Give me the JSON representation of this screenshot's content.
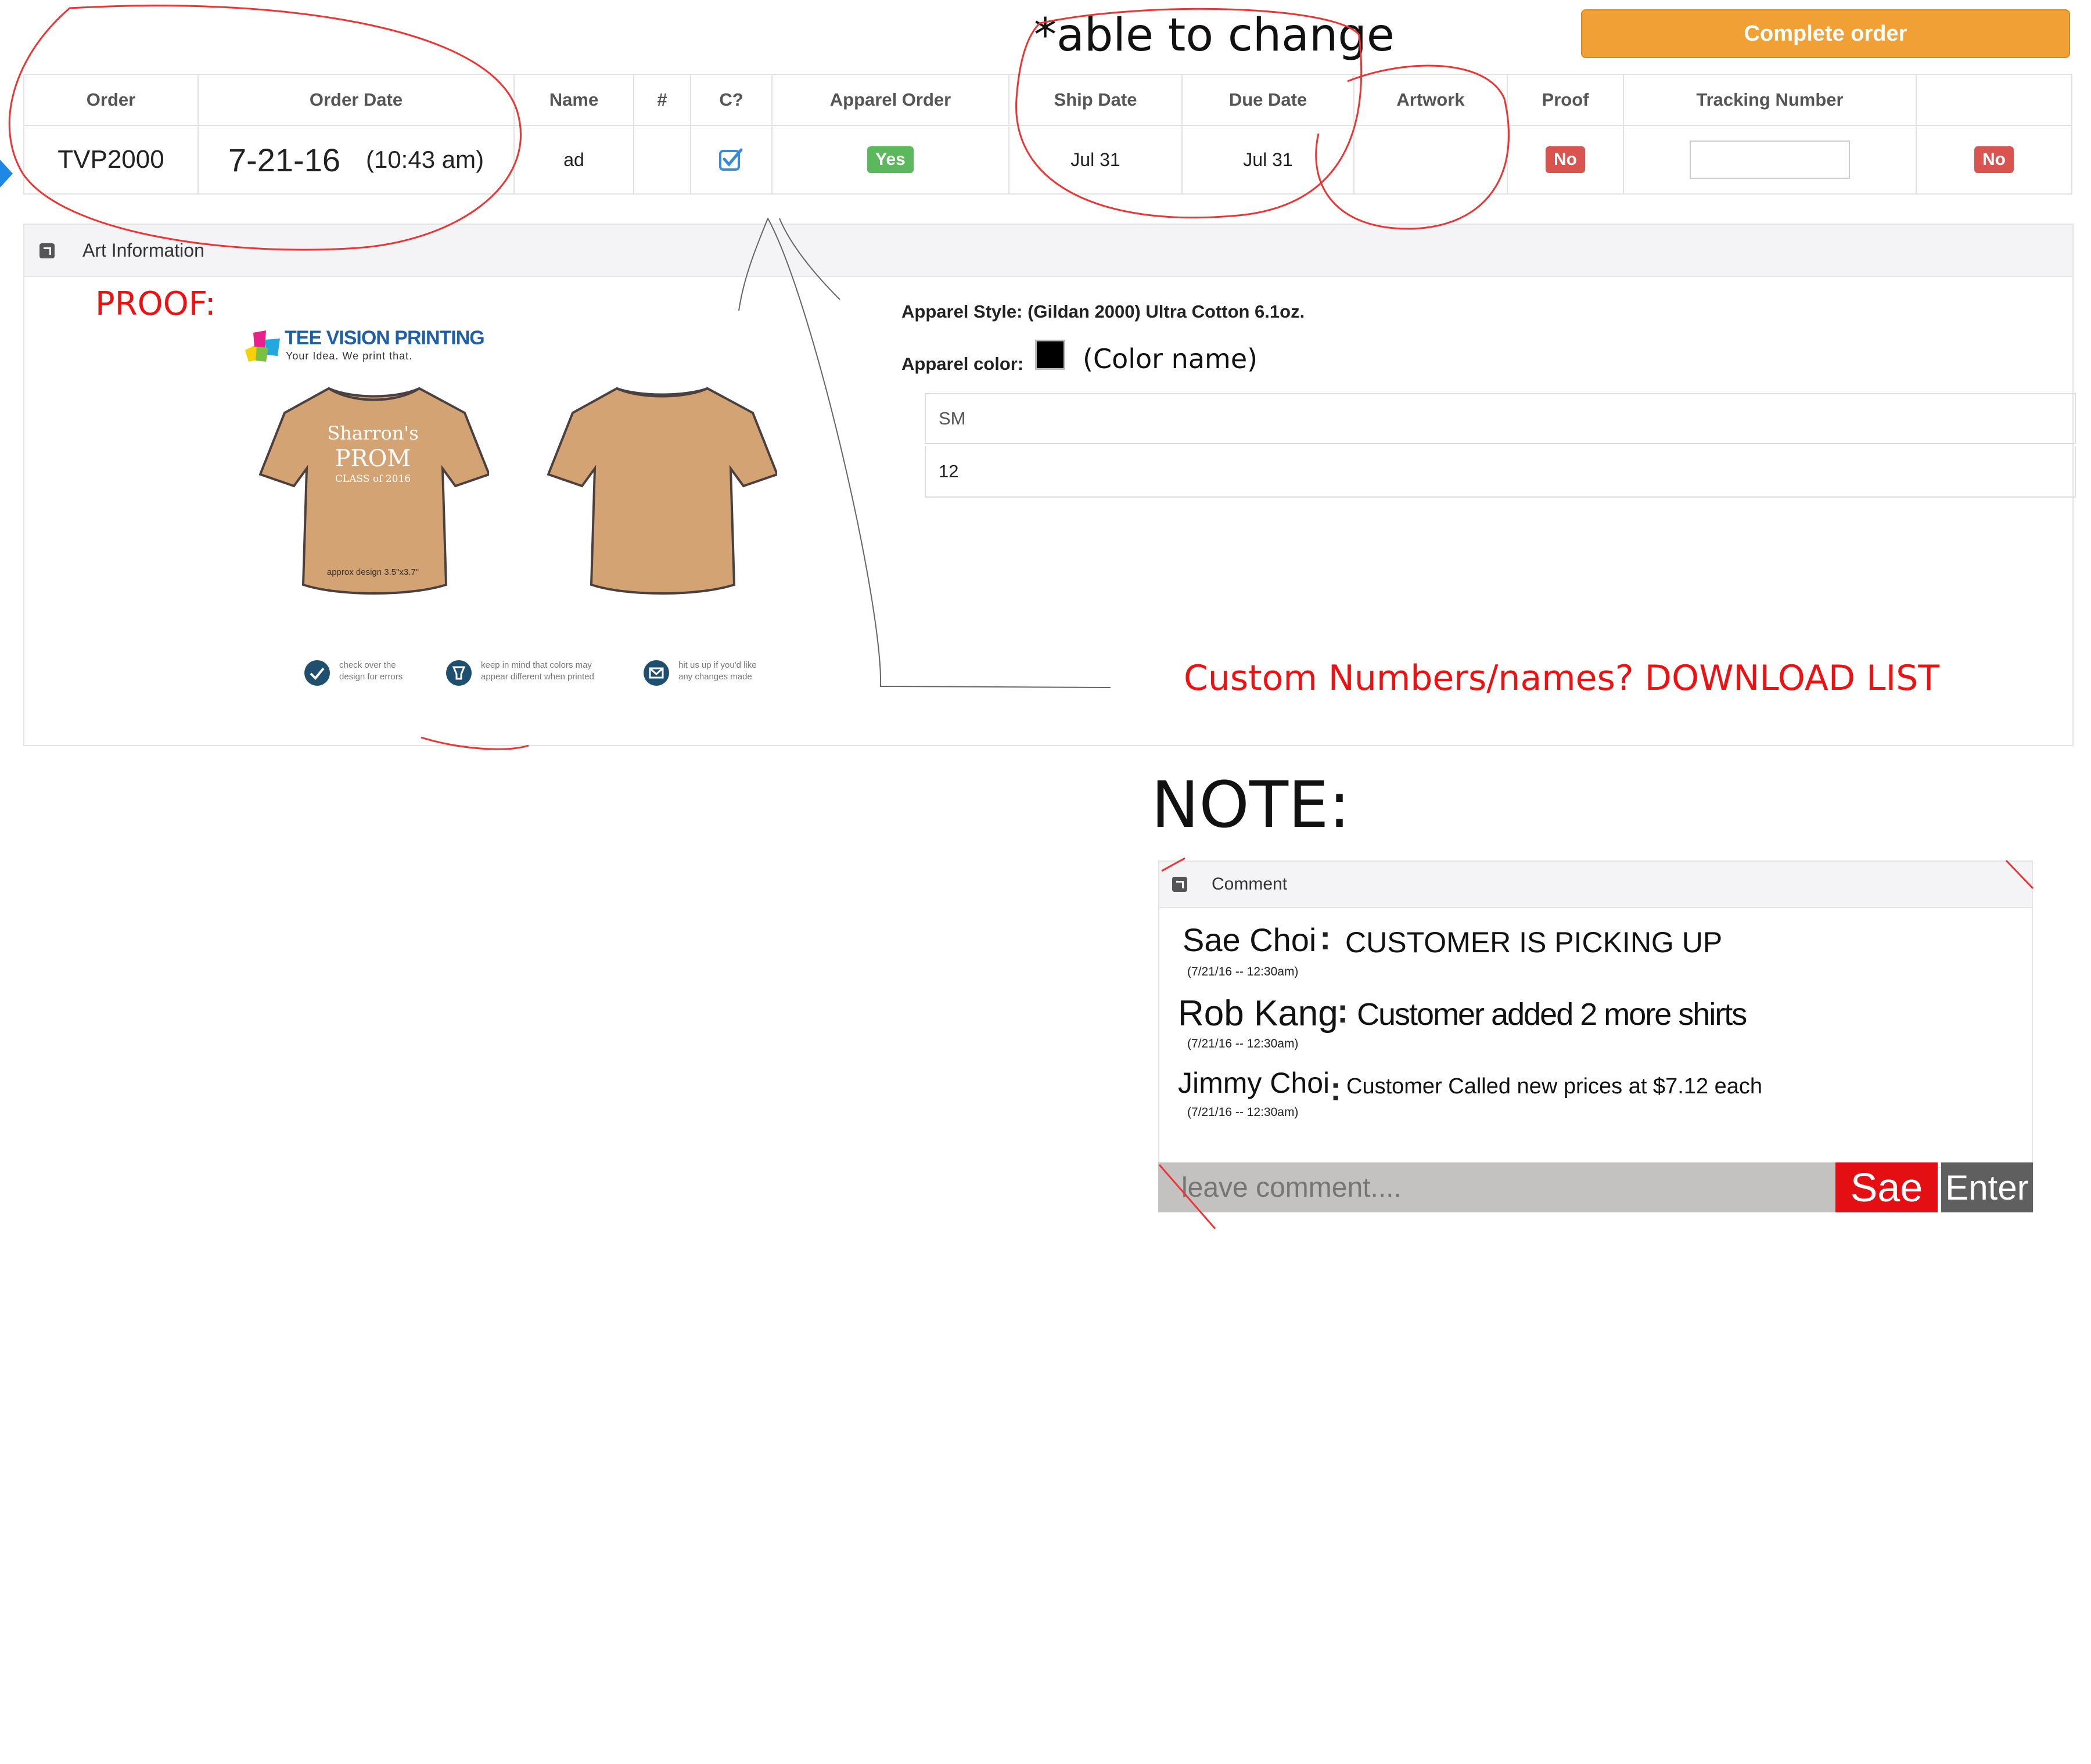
{
  "annotations": {
    "able_to_change": "*able to change",
    "proof": "PROOF:",
    "custom_numbers": "Custom Numbers/names? DOWNLOAD LIST",
    "note": "NOTE:"
  },
  "header": {
    "complete_order_label": "Complete order"
  },
  "table": {
    "headers": [
      "Order",
      "Order Date",
      "Name",
      "#",
      "C?",
      "Apparel Order",
      "Ship Date",
      "Due Date",
      "Artwork",
      "Proof",
      "Tracking Number",
      ""
    ],
    "row": {
      "order": "TVP2000",
      "order_date": "7-21-16",
      "order_time": "(10:43 am)",
      "name": "ad",
      "number": "",
      "apparel_order": "Yes",
      "ship_date": "Jul 31",
      "due_date": "Jul 31",
      "artwork": "",
      "proof": "No",
      "tracking_number": "",
      "last": "No"
    }
  },
  "art_panel": {
    "title": "Art Information",
    "brand_name": "TEE VISION PRINTING",
    "brand_tagline": "Your Idea. We print that.",
    "shirt_text_1": "Sharron's",
    "shirt_text_2": "PROM",
    "shirt_text_3": "CLASS of 2016",
    "approx_design": "approx design 3.5\"x3.7\"",
    "notes": [
      {
        "icon": "check-icon",
        "text1": "check over the",
        "text2": "design for errors"
      },
      {
        "icon": "paint-bucket-icon",
        "text1": "keep in mind that colors may",
        "text2": "appear different when printed"
      },
      {
        "icon": "mail-icon",
        "text1": "hit us up if you'd like",
        "text2": "any changes made"
      }
    ],
    "apparel_style_label": "Apparel Style:",
    "apparel_style_value": "(Gildan 2000) Ultra Cotton 6.1oz.",
    "apparel_color_label": "Apparel color:",
    "apparel_color_name": "(Color name)",
    "size_label": "SM",
    "size_qty": "12"
  },
  "comments": {
    "title": "Comment",
    "items": [
      {
        "name": "Sae Choi",
        "timestamp": "(7/21/16 -- 12:30am)",
        "text": "CUSTOMER IS PICKING UP"
      },
      {
        "name": "Rob Kang",
        "timestamp": "(7/21/16 -- 12:30am)",
        "text": "Customer  added 2 more shirts"
      },
      {
        "name": "Jimmy Choi",
        "timestamp": "(7/21/16 -- 12:30am)",
        "text": "Customer Called new prices at $7.12 each"
      }
    ],
    "input_placeholder": "leave comment....",
    "save_label": "Sae",
    "enter_label": "Enter"
  },
  "colors": {
    "orange": "#f0a035",
    "green": "#5cb85c",
    "red_badge": "#d9534f",
    "annotation_red": "#ee1111",
    "shirt": "#d4a373"
  }
}
